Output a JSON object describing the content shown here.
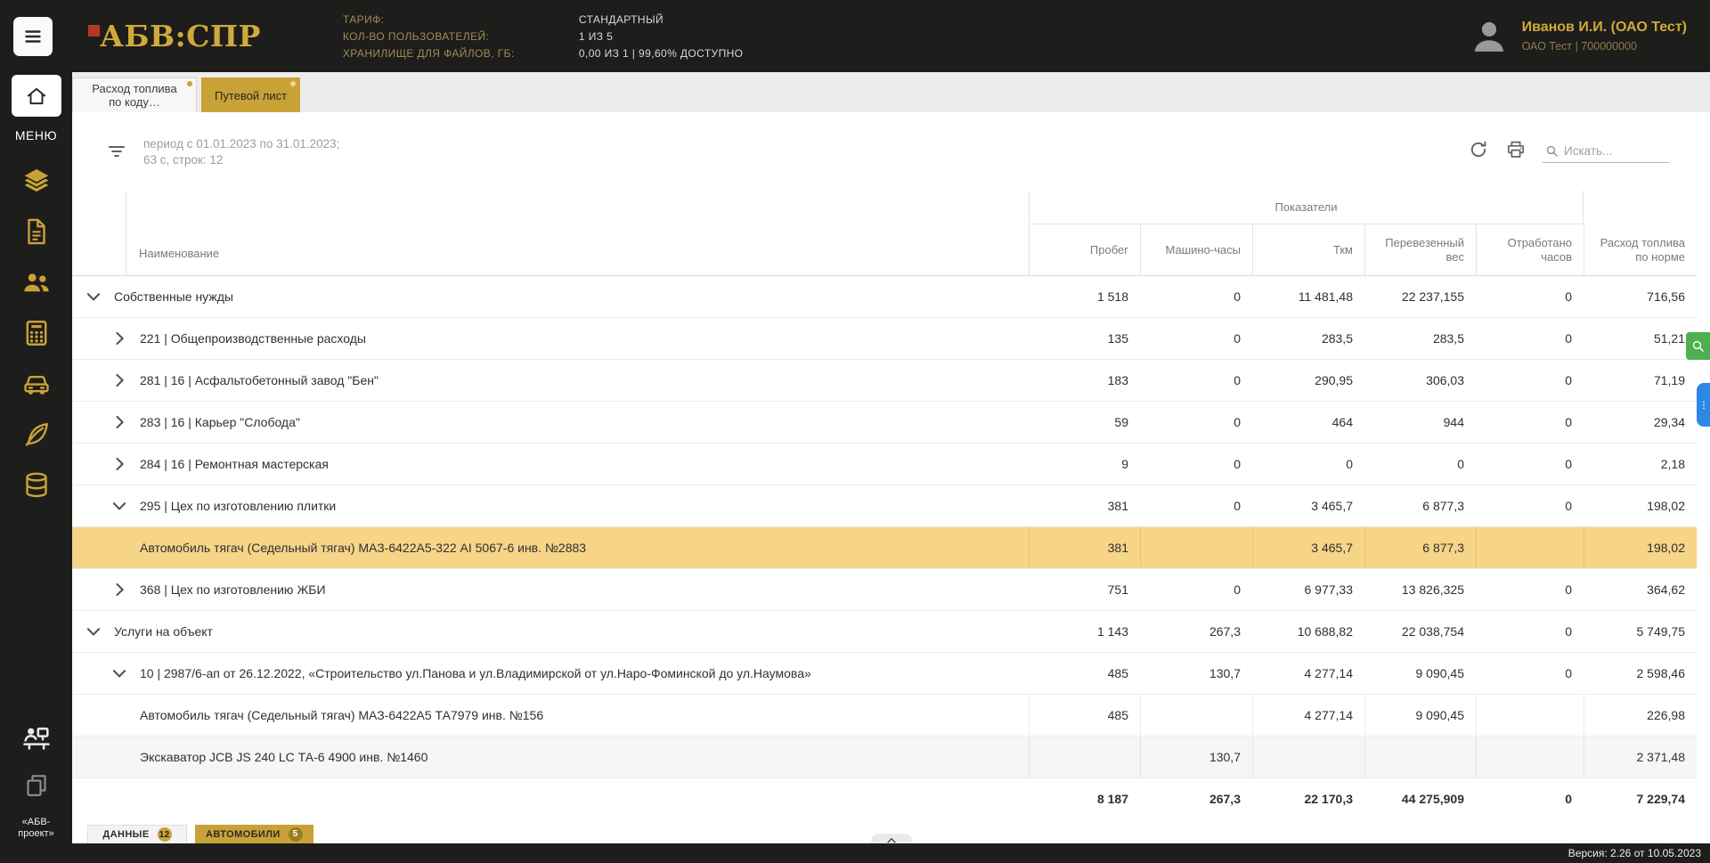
{
  "header": {
    "logo": "АБВ:СПР",
    "tariff_label": "ТАРИФ:",
    "tariff_value": "СТАНДАРТНЫЙ",
    "users_label": "КОЛ-ВО ПОЛЬЗОВАТЕЛЕЙ:",
    "users_value": "1 ИЗ 5",
    "storage_label": "ХРАНИЛИЩЕ ДЛЯ ФАЙЛОВ, ГБ:",
    "storage_value": "0,00 ИЗ 1 | 99,60% ДОСТУПНО",
    "user_name": "Иванов И.И. (ОАО Тест)",
    "user_org": "ОАО Тест | 700000000"
  },
  "sidebar": {
    "menu_label": "МЕНЮ",
    "items": [
      {
        "name": "layers",
        "icon": "layers"
      },
      {
        "name": "waybill",
        "icon": "document"
      },
      {
        "name": "users",
        "icon": "users"
      },
      {
        "name": "calculator",
        "icon": "calculator"
      },
      {
        "name": "vehicles",
        "icon": "car"
      },
      {
        "name": "eco",
        "icon": "leaf"
      },
      {
        "name": "database",
        "icon": "database"
      }
    ],
    "footer_label": "«АБВ-проект»"
  },
  "tabs": [
    {
      "label": "Расход топлива по коду…",
      "active": false
    },
    {
      "label": "Путевой лист",
      "active": true
    }
  ],
  "toolbar": {
    "period_line1": "период с 01.01.2023 по 31.01.2023;",
    "period_line2": "63 с, строк: 12",
    "search_placeholder": "Искать..."
  },
  "table": {
    "group_header": "Показатели",
    "columns": [
      "Наименование",
      "Пробег",
      "Машино-часы",
      "Ткм",
      "Перевезенный вес",
      "Отработано часов",
      "Расход топлива по норме"
    ],
    "rows": [
      {
        "level": 0,
        "chev": "open",
        "name": "Собственные нужды",
        "values": [
          "1 518",
          "0",
          "11 481,48",
          "22 237,155",
          "0",
          "716,56"
        ]
      },
      {
        "level": 1,
        "chev": "closed",
        "name": "221 | Общепроизводственные расходы",
        "values": [
          "135",
          "0",
          "283,5",
          "283,5",
          "0",
          "51,21"
        ]
      },
      {
        "level": 1,
        "chev": "closed",
        "name": "281 | 16 | Асфальтобетонный завод \"Бен\"",
        "values": [
          "183",
          "0",
          "290,95",
          "306,03",
          "0",
          "71,19"
        ]
      },
      {
        "level": 1,
        "chev": "closed",
        "name": "283 | 16 | Карьер \"Слобода\"",
        "values": [
          "59",
          "0",
          "464",
          "944",
          "0",
          "29,34"
        ]
      },
      {
        "level": 1,
        "chev": "closed",
        "name": "284 | 16 | Ремонтная мастерская",
        "values": [
          "9",
          "0",
          "0",
          "0",
          "0",
          "2,18"
        ]
      },
      {
        "level": 1,
        "chev": "open",
        "name": "295 | Цех по изготовлению плитки",
        "values": [
          "381",
          "0",
          "3 465,7",
          "6 877,3",
          "0",
          "198,02"
        ]
      },
      {
        "level": 2,
        "chev": null,
        "selected": true,
        "name": "Автомобиль тягач (Седельный тягач) МАЗ-6422А5-322 AI 5067-6 инв. №2883",
        "values": [
          "381",
          "",
          "3 465,7",
          "6 877,3",
          "",
          "198,02"
        ]
      },
      {
        "level": 1,
        "chev": "closed",
        "name": "368 | Цех по изготовлению ЖБИ",
        "values": [
          "751",
          "0",
          "6 977,33",
          "13 826,325",
          "0",
          "364,62"
        ]
      },
      {
        "level": 0,
        "chev": "open",
        "name": "Услуги на объект",
        "values": [
          "1 143",
          "267,3",
          "10 688,82",
          "22 038,754",
          "0",
          "5 749,75"
        ]
      },
      {
        "level": 1,
        "chev": "open",
        "name": "10 | 2987/6-ап от 26.12.2022, «Строительство ул.Панова и ул.Владимирской от ул.Наро-Фоминской до ул.Наумова»",
        "values": [
          "485",
          "130,7",
          "4 277,14",
          "9 090,45",
          "0",
          "2 598,46"
        ]
      },
      {
        "level": 2,
        "chev": null,
        "name": "Автомобиль тягач (Седельный тягач) МАЗ-6422А5 ТА7979 инв. №156",
        "values": [
          "485",
          "",
          "4 277,14",
          "9 090,45",
          "",
          "226,98"
        ]
      },
      {
        "level": 2,
        "chev": null,
        "stripe": true,
        "name": "Экскаватор JCB JS 240 LC ТА-6 4900 инв. №1460",
        "values": [
          "",
          "130,7",
          "",
          "",
          "",
          "2 371,48"
        ]
      }
    ],
    "totals": [
      "8 187",
      "267,3",
      "22 170,3",
      "44 275,909",
      "0",
      "7 229,74"
    ]
  },
  "bottom_tabs": [
    {
      "label": "ДАННЫЕ",
      "badge": "12",
      "active": true
    },
    {
      "label": "АВТОМОБИЛИ",
      "badge": "5",
      "active": false
    }
  ],
  "statusbar": {
    "version": "Версия: 2.26 от 10.05.2023"
  },
  "colors": {
    "accent_gold": "#c9a237",
    "header_bg": "#1d1d1b",
    "selected_row": "#f6d488",
    "logo_red": "#b5372c",
    "search_button_green": "#4caf50",
    "options_button_blue": "#2e86e6"
  }
}
